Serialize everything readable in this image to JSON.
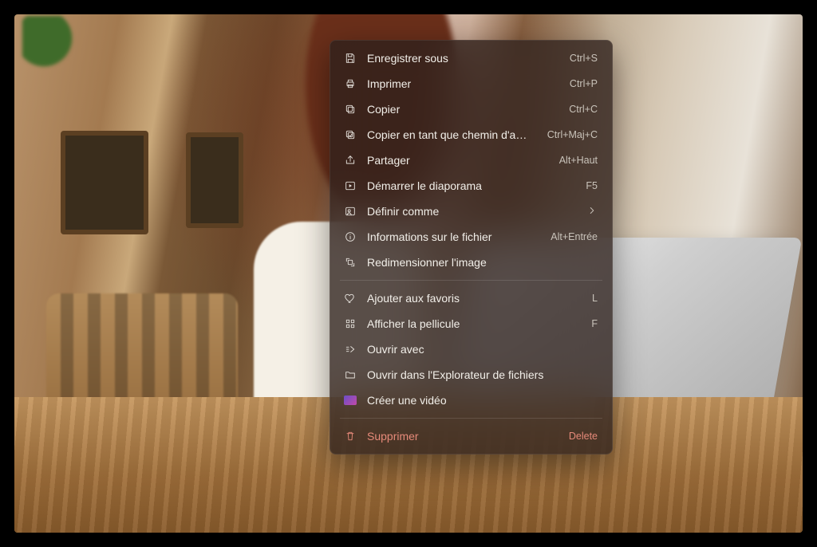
{
  "menu": {
    "group1": [
      {
        "key": "save_as",
        "label": "Enregistrer sous",
        "accel": "Ctrl+S",
        "icon": "save-icon"
      },
      {
        "key": "print",
        "label": "Imprimer",
        "accel": "Ctrl+P",
        "icon": "printer-icon"
      },
      {
        "key": "copy",
        "label": "Copier",
        "accel": "Ctrl+C",
        "icon": "copy-icon"
      },
      {
        "key": "copy_path",
        "label": "Copier en tant que chemin d'accès",
        "accel": "Ctrl+Maj+C",
        "icon": "copy-path-icon"
      },
      {
        "key": "share",
        "label": "Partager",
        "accel": "Alt+Haut",
        "icon": "share-icon"
      },
      {
        "key": "slideshow",
        "label": "Démarrer le diaporama",
        "accel": "F5",
        "icon": "play-box-icon"
      },
      {
        "key": "set_as",
        "label": "Définir comme",
        "submenu": true,
        "icon": "picture-person-icon"
      },
      {
        "key": "file_info",
        "label": "Informations sur le fichier",
        "accel": "Alt+Entrée",
        "icon": "info-icon"
      },
      {
        "key": "resize",
        "label": "Redimensionner l'image",
        "icon": "resize-icon"
      }
    ],
    "group2": [
      {
        "key": "favorite",
        "label": "Ajouter aux favoris",
        "accel": "L",
        "icon": "heart-icon"
      },
      {
        "key": "filmstrip",
        "label": "Afficher la pellicule",
        "accel": "F",
        "icon": "grid-icon"
      },
      {
        "key": "open_with",
        "label": "Ouvrir avec",
        "icon": "open-with-icon"
      },
      {
        "key": "open_expl",
        "label": "Ouvrir dans l'Explorateur de fichiers",
        "icon": "folder-icon"
      },
      {
        "key": "create_video",
        "label": "Créer une vidéo",
        "icon": "video-gradient-icon"
      }
    ],
    "group3": [
      {
        "key": "delete",
        "label": "Supprimer",
        "accel": "Delete",
        "icon": "trash-icon",
        "danger": true
      }
    ]
  }
}
